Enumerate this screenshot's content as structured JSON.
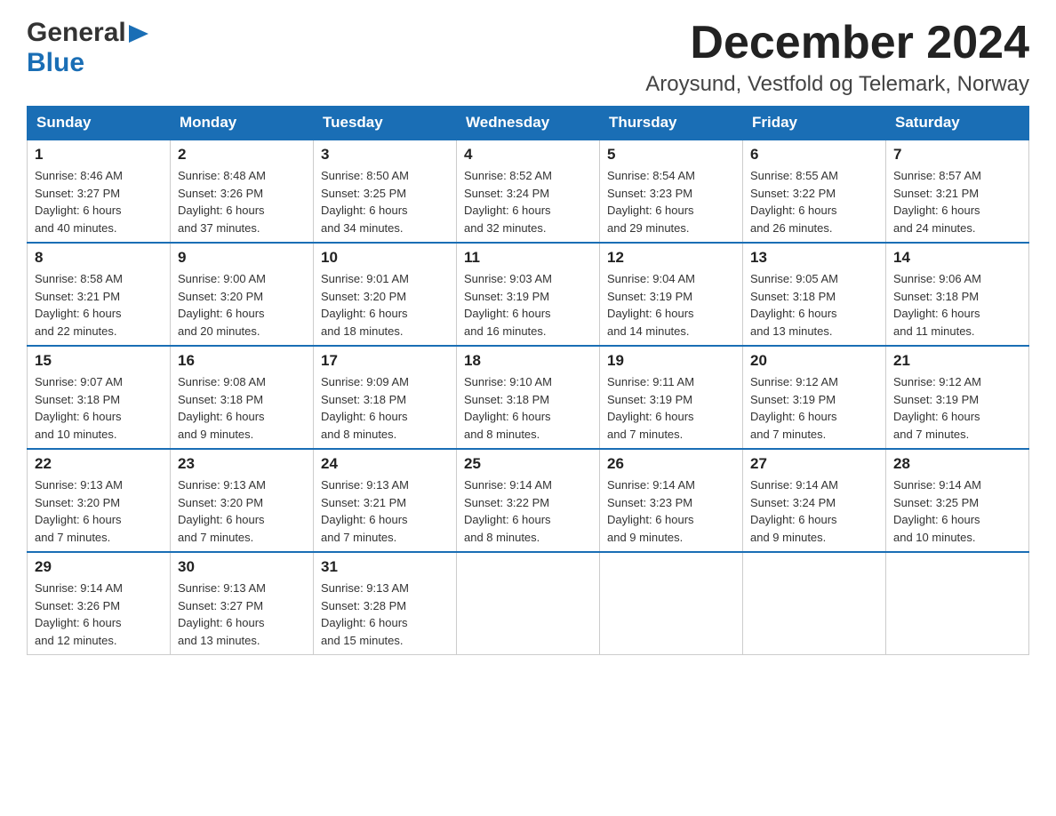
{
  "header": {
    "logo_general": "General",
    "logo_blue": "Blue",
    "title": "December 2024",
    "subtitle": "Aroysund, Vestfold og Telemark, Norway"
  },
  "weekdays": [
    "Sunday",
    "Monday",
    "Tuesday",
    "Wednesday",
    "Thursday",
    "Friday",
    "Saturday"
  ],
  "weeks": [
    [
      {
        "day": "1",
        "info": "Sunrise: 8:46 AM\nSunset: 3:27 PM\nDaylight: 6 hours\nand 40 minutes."
      },
      {
        "day": "2",
        "info": "Sunrise: 8:48 AM\nSunset: 3:26 PM\nDaylight: 6 hours\nand 37 minutes."
      },
      {
        "day": "3",
        "info": "Sunrise: 8:50 AM\nSunset: 3:25 PM\nDaylight: 6 hours\nand 34 minutes."
      },
      {
        "day": "4",
        "info": "Sunrise: 8:52 AM\nSunset: 3:24 PM\nDaylight: 6 hours\nand 32 minutes."
      },
      {
        "day": "5",
        "info": "Sunrise: 8:54 AM\nSunset: 3:23 PM\nDaylight: 6 hours\nand 29 minutes."
      },
      {
        "day": "6",
        "info": "Sunrise: 8:55 AM\nSunset: 3:22 PM\nDaylight: 6 hours\nand 26 minutes."
      },
      {
        "day": "7",
        "info": "Sunrise: 8:57 AM\nSunset: 3:21 PM\nDaylight: 6 hours\nand 24 minutes."
      }
    ],
    [
      {
        "day": "8",
        "info": "Sunrise: 8:58 AM\nSunset: 3:21 PM\nDaylight: 6 hours\nand 22 minutes."
      },
      {
        "day": "9",
        "info": "Sunrise: 9:00 AM\nSunset: 3:20 PM\nDaylight: 6 hours\nand 20 minutes."
      },
      {
        "day": "10",
        "info": "Sunrise: 9:01 AM\nSunset: 3:20 PM\nDaylight: 6 hours\nand 18 minutes."
      },
      {
        "day": "11",
        "info": "Sunrise: 9:03 AM\nSunset: 3:19 PM\nDaylight: 6 hours\nand 16 minutes."
      },
      {
        "day": "12",
        "info": "Sunrise: 9:04 AM\nSunset: 3:19 PM\nDaylight: 6 hours\nand 14 minutes."
      },
      {
        "day": "13",
        "info": "Sunrise: 9:05 AM\nSunset: 3:18 PM\nDaylight: 6 hours\nand 13 minutes."
      },
      {
        "day": "14",
        "info": "Sunrise: 9:06 AM\nSunset: 3:18 PM\nDaylight: 6 hours\nand 11 minutes."
      }
    ],
    [
      {
        "day": "15",
        "info": "Sunrise: 9:07 AM\nSunset: 3:18 PM\nDaylight: 6 hours\nand 10 minutes."
      },
      {
        "day": "16",
        "info": "Sunrise: 9:08 AM\nSunset: 3:18 PM\nDaylight: 6 hours\nand 9 minutes."
      },
      {
        "day": "17",
        "info": "Sunrise: 9:09 AM\nSunset: 3:18 PM\nDaylight: 6 hours\nand 8 minutes."
      },
      {
        "day": "18",
        "info": "Sunrise: 9:10 AM\nSunset: 3:18 PM\nDaylight: 6 hours\nand 8 minutes."
      },
      {
        "day": "19",
        "info": "Sunrise: 9:11 AM\nSunset: 3:19 PM\nDaylight: 6 hours\nand 7 minutes."
      },
      {
        "day": "20",
        "info": "Sunrise: 9:12 AM\nSunset: 3:19 PM\nDaylight: 6 hours\nand 7 minutes."
      },
      {
        "day": "21",
        "info": "Sunrise: 9:12 AM\nSunset: 3:19 PM\nDaylight: 6 hours\nand 7 minutes."
      }
    ],
    [
      {
        "day": "22",
        "info": "Sunrise: 9:13 AM\nSunset: 3:20 PM\nDaylight: 6 hours\nand 7 minutes."
      },
      {
        "day": "23",
        "info": "Sunrise: 9:13 AM\nSunset: 3:20 PM\nDaylight: 6 hours\nand 7 minutes."
      },
      {
        "day": "24",
        "info": "Sunrise: 9:13 AM\nSunset: 3:21 PM\nDaylight: 6 hours\nand 7 minutes."
      },
      {
        "day": "25",
        "info": "Sunrise: 9:14 AM\nSunset: 3:22 PM\nDaylight: 6 hours\nand 8 minutes."
      },
      {
        "day": "26",
        "info": "Sunrise: 9:14 AM\nSunset: 3:23 PM\nDaylight: 6 hours\nand 9 minutes."
      },
      {
        "day": "27",
        "info": "Sunrise: 9:14 AM\nSunset: 3:24 PM\nDaylight: 6 hours\nand 9 minutes."
      },
      {
        "day": "28",
        "info": "Sunrise: 9:14 AM\nSunset: 3:25 PM\nDaylight: 6 hours\nand 10 minutes."
      }
    ],
    [
      {
        "day": "29",
        "info": "Sunrise: 9:14 AM\nSunset: 3:26 PM\nDaylight: 6 hours\nand 12 minutes."
      },
      {
        "day": "30",
        "info": "Sunrise: 9:13 AM\nSunset: 3:27 PM\nDaylight: 6 hours\nand 13 minutes."
      },
      {
        "day": "31",
        "info": "Sunrise: 9:13 AM\nSunset: 3:28 PM\nDaylight: 6 hours\nand 15 minutes."
      },
      {
        "day": "",
        "info": ""
      },
      {
        "day": "",
        "info": ""
      },
      {
        "day": "",
        "info": ""
      },
      {
        "day": "",
        "info": ""
      }
    ]
  ]
}
